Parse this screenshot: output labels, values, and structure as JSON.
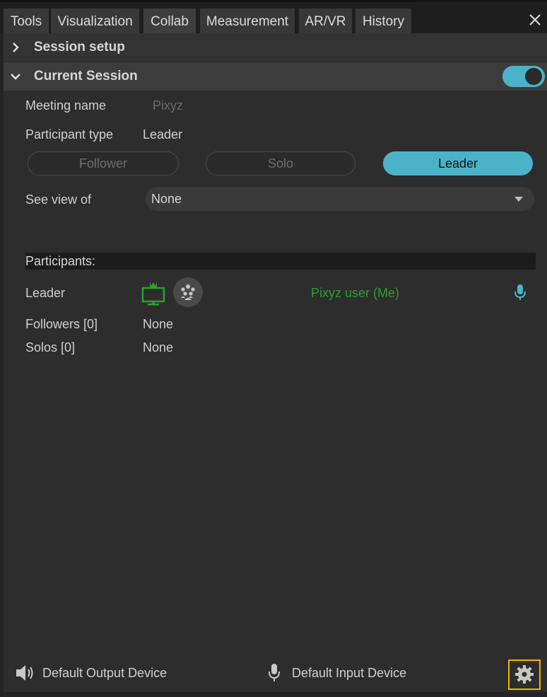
{
  "tabs": [
    {
      "label": "Tools"
    },
    {
      "label": "Visualization"
    },
    {
      "label": "Collab"
    },
    {
      "label": "Measurement"
    },
    {
      "label": "AR/VR"
    },
    {
      "label": "History"
    }
  ],
  "active_tab": "Collab",
  "sections": {
    "session_setup": {
      "title": "Session setup",
      "expanded": false
    },
    "current_session": {
      "title": "Current Session",
      "expanded": true,
      "enabled": true
    }
  },
  "fields": {
    "meeting_name": {
      "label": "Meeting name",
      "value": "Pixyz"
    },
    "participant_type": {
      "label": "Participant type",
      "value": "Leader"
    },
    "see_view_of": {
      "label": "See view of",
      "value": "None"
    }
  },
  "participant_buttons": [
    {
      "label": "Follower",
      "selected": false
    },
    {
      "label": "Solo",
      "selected": false
    },
    {
      "label": "Leader",
      "selected": true
    }
  ],
  "participants": {
    "header": "Participants:",
    "leader": {
      "label": "Leader",
      "name": "Pixyz user (Me)"
    },
    "followers": {
      "label": "Followers [0]",
      "value": "None"
    },
    "solos": {
      "label": "Solos [0]",
      "value": "None"
    }
  },
  "footer": {
    "output_device": "Default Output Device",
    "input_device": "Default Input Device"
  },
  "colors": {
    "accent": "#4ab3c8",
    "leader_green": "#2f9e2f",
    "highlight": "#f0b400"
  }
}
